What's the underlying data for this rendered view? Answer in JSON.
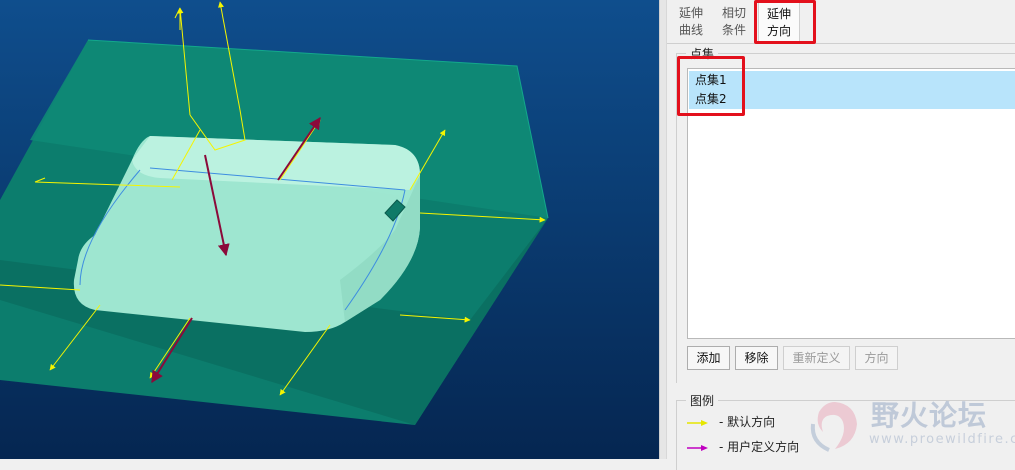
{
  "tabs": [
    {
      "line1": "延伸",
      "line2": "曲线"
    },
    {
      "line1": "相切",
      "line2": "条件"
    },
    {
      "line1": "延伸",
      "line2": "方向"
    }
  ],
  "pointset": {
    "title": "点集",
    "items": [
      "点集1",
      "点集2"
    ]
  },
  "buttons": {
    "add": "添加",
    "remove": "移除",
    "redefine": "重新定义",
    "direction": "方向"
  },
  "legend": {
    "title": "图例",
    "default_direction": "-  默认方向",
    "user_direction": "-  用户定义方向"
  },
  "watermark": {
    "title": "野火论坛",
    "url": "www.proewildfire.cn"
  },
  "colors": {
    "viewport_top": "#0d4c8a",
    "viewport_bottom": "#062a55",
    "mold_box": "#0d8a74",
    "part": "#aef0dd",
    "default_arrow": "#f5f500",
    "user_arrow": "#8b0a3a",
    "highlight": "#e3101c",
    "selected_row": "#b8e4fb"
  }
}
